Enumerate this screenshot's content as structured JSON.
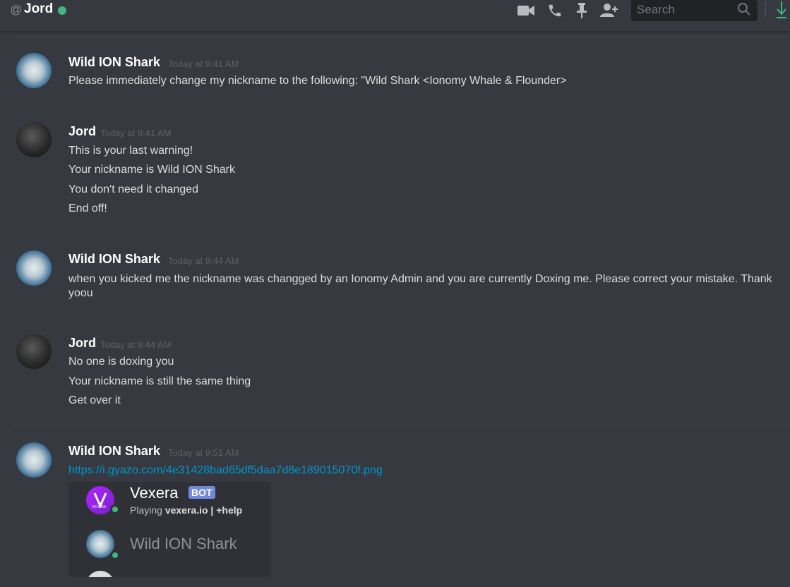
{
  "header": {
    "at_symbol": "@",
    "channel_name": "Jord",
    "search_placeholder": "Search",
    "icons": [
      "video-call-icon",
      "voice-call-icon",
      "pin-icon",
      "add-friend-icon",
      "search-icon",
      "download-icon"
    ]
  },
  "messages": [
    {
      "author": "Wild ION Shark",
      "timestamp": "Today at 9:41 AM",
      "lines": [
        "Please immediately change my nickname to the following: \"Wild Shark <Ionomy Whale & Flounder>"
      ]
    },
    {
      "author": "Jord",
      "timestamp": "Today at 9:41 AM",
      "lines": [
        "This is your last warning!",
        "Your nickname is Wild ION Shark",
        "You don't need it changed",
        "End off!"
      ]
    },
    {
      "author": "Wild ION Shark",
      "timestamp": "Today at 9:44 AM",
      "lines": [
        "when you kicked me the nickname was changged by an Ionomy Admin and you are currently Doxing me. Please correct your mistake. Thank yoou"
      ]
    },
    {
      "author": "Jord",
      "timestamp": "Today at 9:44 AM",
      "lines": [
        "No one is doxing you",
        "Your nickname is still the same thing",
        "Get over it"
      ]
    },
    {
      "author": "Wild ION Shark",
      "timestamp": "Today at 9:51 AM",
      "link": "https://i.gyazo.com/4e31428bad65df5daa7d8e189015070f.png"
    }
  ],
  "embed": {
    "member1": {
      "name": "Vexera",
      "tag": "BOT",
      "avatar_text": "VEXERA",
      "activity_prefix": "Playing",
      "activity_game": "vexera.io | +help"
    },
    "member2": {
      "name": "Wild ION Shark"
    }
  },
  "colors": {
    "background": "#36393f",
    "online": "#43b581",
    "link": "#0096cf",
    "bot_tag": "#7289da",
    "accent_download": "#43b581"
  }
}
